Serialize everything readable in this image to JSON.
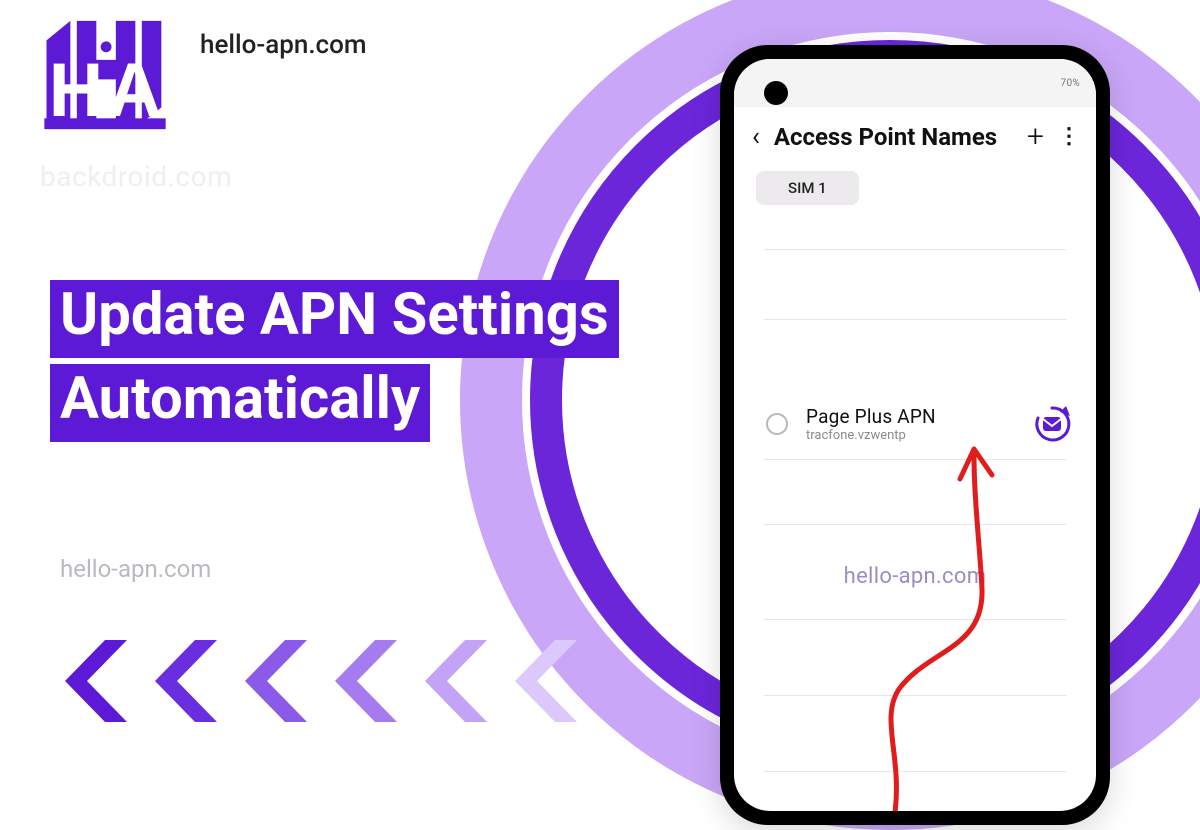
{
  "brand": {
    "logo_letters": "H.A",
    "url": "hello-apn.com",
    "faint_url": "backdroid.com"
  },
  "headline": {
    "line1": "Update APN Settings",
    "line2": "Automatically"
  },
  "watermarks": {
    "mid_left": "hello-apn.com",
    "on_screen": "hello-apn.com"
  },
  "phone": {
    "status_right": "70%",
    "header_title": "Access Point Names",
    "add_label": "+",
    "more_label": "⋮",
    "back_label": "‹",
    "sim_chip": "SIM 1",
    "apn": {
      "title": "Page Plus APN",
      "subtitle": "tracfone.vzwentp"
    }
  },
  "colors": {
    "accent": "#5c19d6",
    "accent_light": "#c9a6f7",
    "scribble": "#e11c1c"
  }
}
